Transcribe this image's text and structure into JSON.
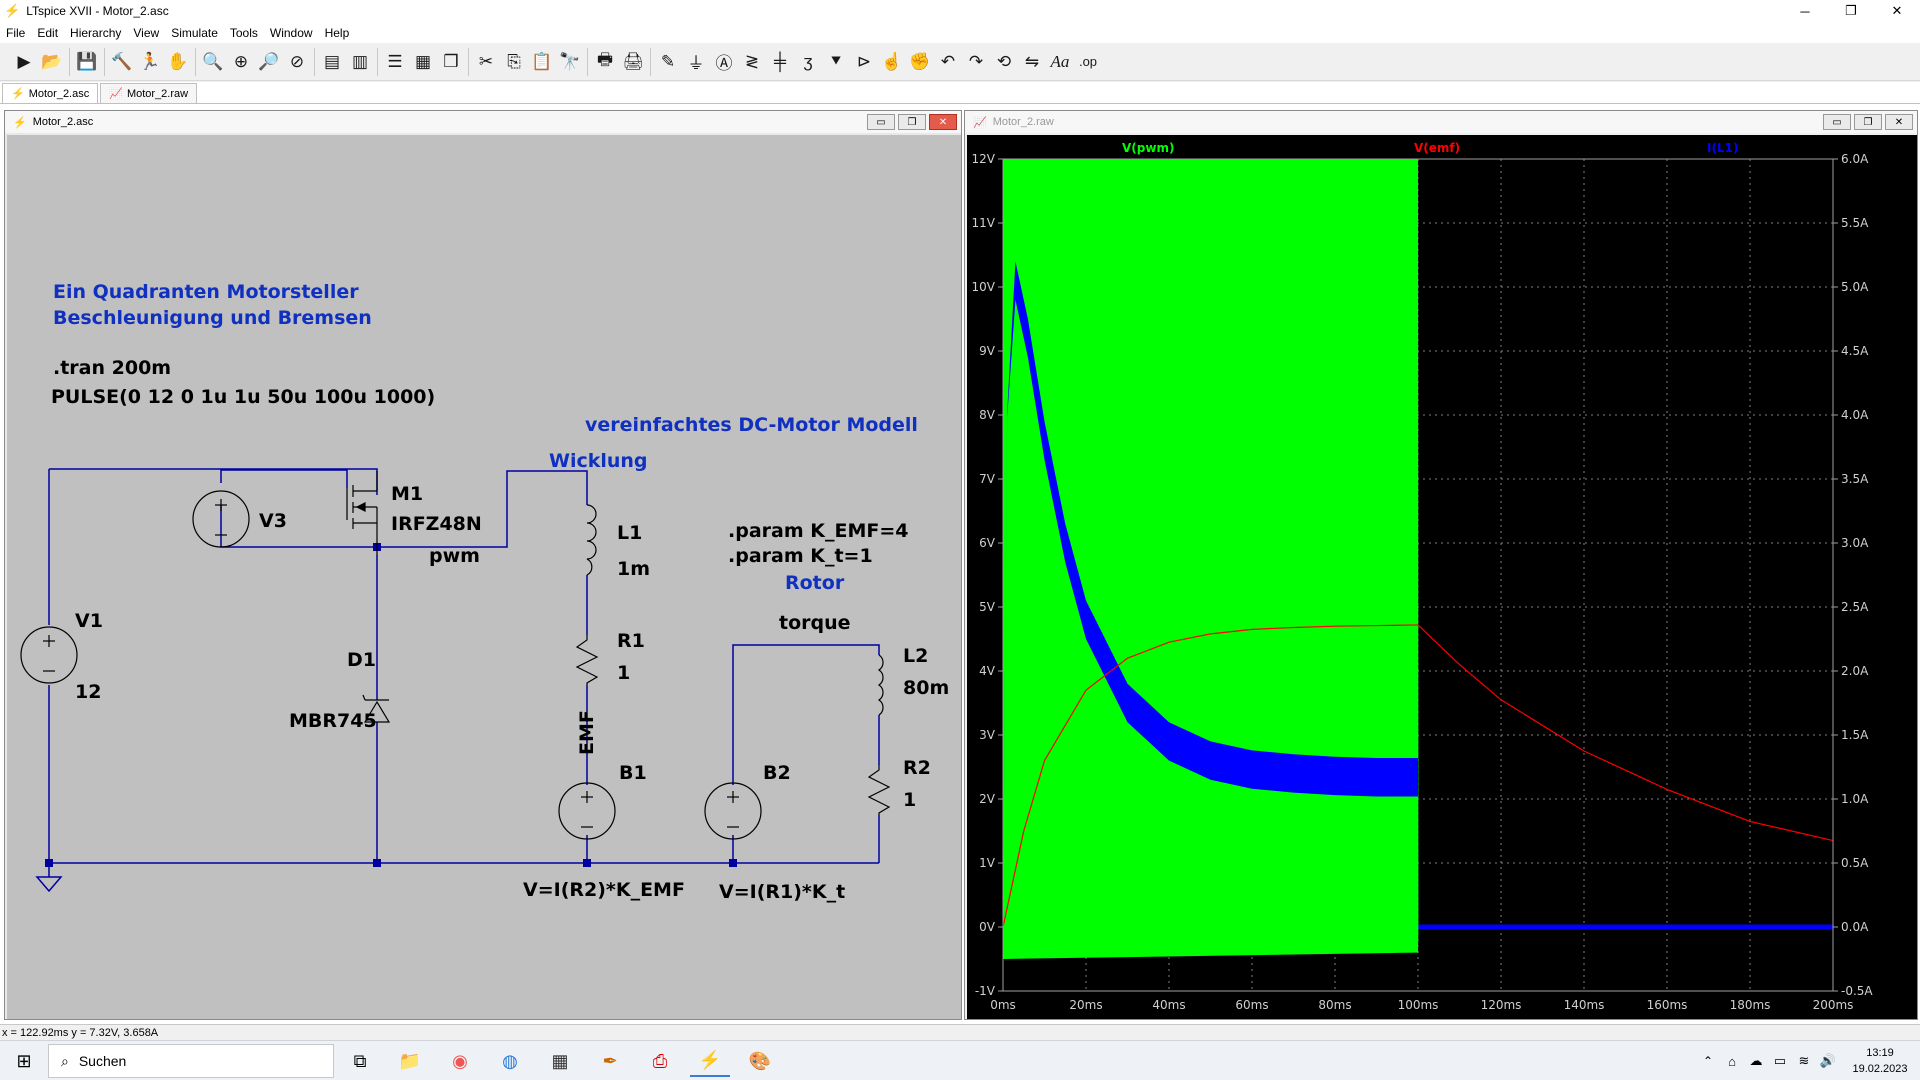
{
  "app": {
    "title": "LTspice XVII - Motor_2.asc",
    "win_min": "─",
    "win_max": "❐",
    "win_close": "✕"
  },
  "menu": [
    "File",
    "Edit",
    "Hierarchy",
    "View",
    "Simulate",
    "Tools",
    "Window",
    "Help"
  ],
  "tabs": [
    {
      "label": "Motor_2.asc"
    },
    {
      "label": "Motor_2.raw"
    }
  ],
  "schematic": {
    "window_title": "Motor_2.asc",
    "heading1": "Ein Quadranten Motorsteller",
    "heading2": "Beschleunigung und Bremsen",
    "tran": ".tran 200m",
    "pulse": "PULSE(0 12 0 1u 1u 50u 100u 1000)",
    "model_title": "vereinfachtes DC-Motor Modell",
    "wicklung": "Wicklung",
    "param1": ".param K_EMF=4",
    "param2": ".param K_t=1",
    "rotor": "Rotor",
    "torque": "torque",
    "pwm": "pwm",
    "emf": "EMF",
    "m1": "M1",
    "m1_part": "IRFZ48N",
    "v3": "V3",
    "v1": "V1",
    "v1_val": "12",
    "d1": "D1",
    "d1_part": "MBR745",
    "l1": "L1",
    "l1_val": "1m",
    "r1": "R1",
    "r1_val": "1",
    "b1": "B1",
    "b1_expr": "V=I(R2)*K_EMF",
    "b2": "B2",
    "b2_expr": "V=I(R1)*K_t",
    "l2": "L2",
    "l2_val": "80m",
    "r2": "R2",
    "r2_val": "1"
  },
  "plot": {
    "window_title": "Motor_2.raw",
    "traces": [
      {
        "name": "V(pwm)",
        "color": "#00ff00"
      },
      {
        "name": "V(emf)",
        "color": "#ff0000"
      },
      {
        "name": "I(L1)",
        "color": "#0000ff"
      }
    ],
    "left_ticks": [
      "12V",
      "11V",
      "10V",
      "9V",
      "8V",
      "7V",
      "6V",
      "5V",
      "4V",
      "3V",
      "2V",
      "1V",
      "0V",
      "-1V"
    ],
    "right_ticks": [
      "6.0A",
      "5.5A",
      "5.0A",
      "4.5A",
      "4.0A",
      "3.5A",
      "3.0A",
      "2.5A",
      "2.0A",
      "1.5A",
      "1.0A",
      "0.5A",
      "0.0A",
      "-0.5A"
    ],
    "x_ticks": [
      "0ms",
      "20ms",
      "40ms",
      "60ms",
      "80ms",
      "100ms",
      "120ms",
      "140ms",
      "160ms",
      "180ms",
      "200ms"
    ]
  },
  "chart_data": {
    "type": "line",
    "xlabel": "",
    "ylabel": "",
    "xlim": [
      0,
      200
    ],
    "ylim_left": [
      -1,
      12
    ],
    "ylim_right": [
      -0.5,
      6.0
    ],
    "grid": true,
    "legend": "top",
    "series": [
      {
        "name": "V(pwm)",
        "axis": "left",
        "note_band": "switching 0-12V",
        "x": [
          0,
          100,
          100.1,
          200
        ],
        "y_high": [
          12,
          12,
          0,
          0
        ],
        "y_low": [
          -0.5,
          -0.4,
          0,
          0
        ]
      },
      {
        "name": "V(emf)",
        "axis": "left",
        "x": [
          0,
          5,
          10,
          20,
          30,
          40,
          50,
          60,
          70,
          80,
          90,
          100,
          110,
          120,
          140,
          160,
          180,
          200
        ],
        "y": [
          0,
          1.5,
          2.6,
          3.7,
          4.2,
          4.45,
          4.58,
          4.65,
          4.68,
          4.7,
          4.71,
          4.72,
          4.1,
          3.55,
          2.75,
          2.15,
          1.65,
          1.35
        ]
      },
      {
        "name": "I(L1)",
        "axis": "right",
        "x": [
          0,
          1,
          3,
          6,
          10,
          15,
          20,
          30,
          40,
          50,
          60,
          70,
          80,
          90,
          100,
          100.1,
          200
        ],
        "y": [
          0.1,
          4.0,
          5.05,
          4.6,
          3.8,
          3.0,
          2.4,
          1.75,
          1.45,
          1.3,
          1.23,
          1.2,
          1.18,
          1.17,
          1.17,
          0,
          0
        ],
        "ripple": 0.15
      }
    ]
  },
  "status": {
    "text": "x = 122.92ms    y = 7.32V, 3.658A"
  },
  "taskbar": {
    "search": "Suchen",
    "time": "13:19",
    "date": "19.02.2023"
  }
}
